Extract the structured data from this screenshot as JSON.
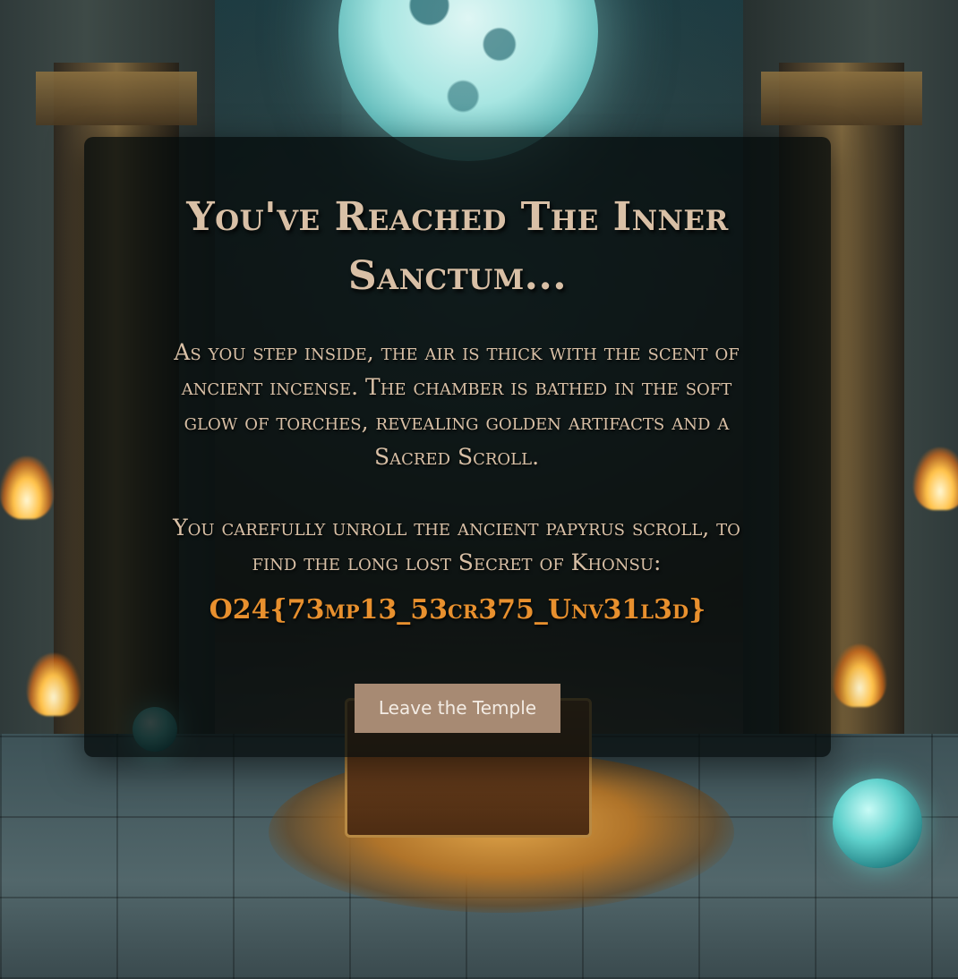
{
  "page": {
    "title": "You've Reached The Inner Sanctum...",
    "intro_paragraph": "As you step inside, the air is thick with the scent of ancient incense. The chamber is bathed in the soft glow of torches, revealing golden artifacts and a Sacred Scroll.",
    "scroll_paragraph": "You carefully unroll the ancient papyrus scroll, to find the long lost Secret of Khonsu:",
    "secret_text": "O24{73mp13_53cr375_Unv31l3d}",
    "leave_button_label": "Leave the Temple"
  },
  "colors": {
    "panel_background": "rgba(5,12,12,0.78)",
    "text": "#d9c0a6",
    "secret": "#e8902e",
    "button_background": "#a78a73",
    "button_text": "#f3ece4"
  }
}
